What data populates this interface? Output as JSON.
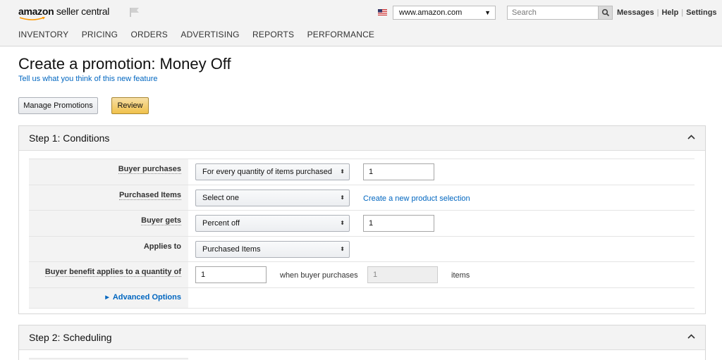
{
  "header": {
    "logo_amazon": "amazon",
    "logo_seller": "seller central",
    "marketplace": "www.amazon.com",
    "search_placeholder": "Search",
    "links": [
      "Messages",
      "Help",
      "Settings"
    ],
    "nav": [
      "INVENTORY",
      "PRICING",
      "ORDERS",
      "ADVERTISING",
      "REPORTS",
      "PERFORMANCE"
    ]
  },
  "page": {
    "title": "Create a promotion: Money Off",
    "feedback_link": "Tell us what you think of this new feature",
    "manage_button": "Manage Promotions",
    "review_button": "Review"
  },
  "step1": {
    "title": "Step 1: Conditions",
    "rows": {
      "buyer_purchases": {
        "label": "Buyer purchases",
        "select": "For every quantity of items purchased",
        "value": "1"
      },
      "purchased_items": {
        "label": "Purchased Items",
        "select": "Select one",
        "link": "Create a new product selection"
      },
      "buyer_gets": {
        "label": "Buyer gets",
        "select": "Percent off",
        "value": "1"
      },
      "applies_to": {
        "label": "Applies to",
        "select": "Purchased Items"
      },
      "benefit_quantity": {
        "label": "Buyer benefit applies to a quantity of",
        "value": "1",
        "middle_text": "when buyer purchases",
        "purchase_value": "1",
        "suffix": "items"
      },
      "advanced": {
        "label": "Advanced Options"
      }
    }
  },
  "step2": {
    "title": "Step 2: Scheduling"
  },
  "colors": {
    "link": "#0066c0",
    "review_button": "#f0c14b",
    "header_bg": "#f3f3f3"
  }
}
